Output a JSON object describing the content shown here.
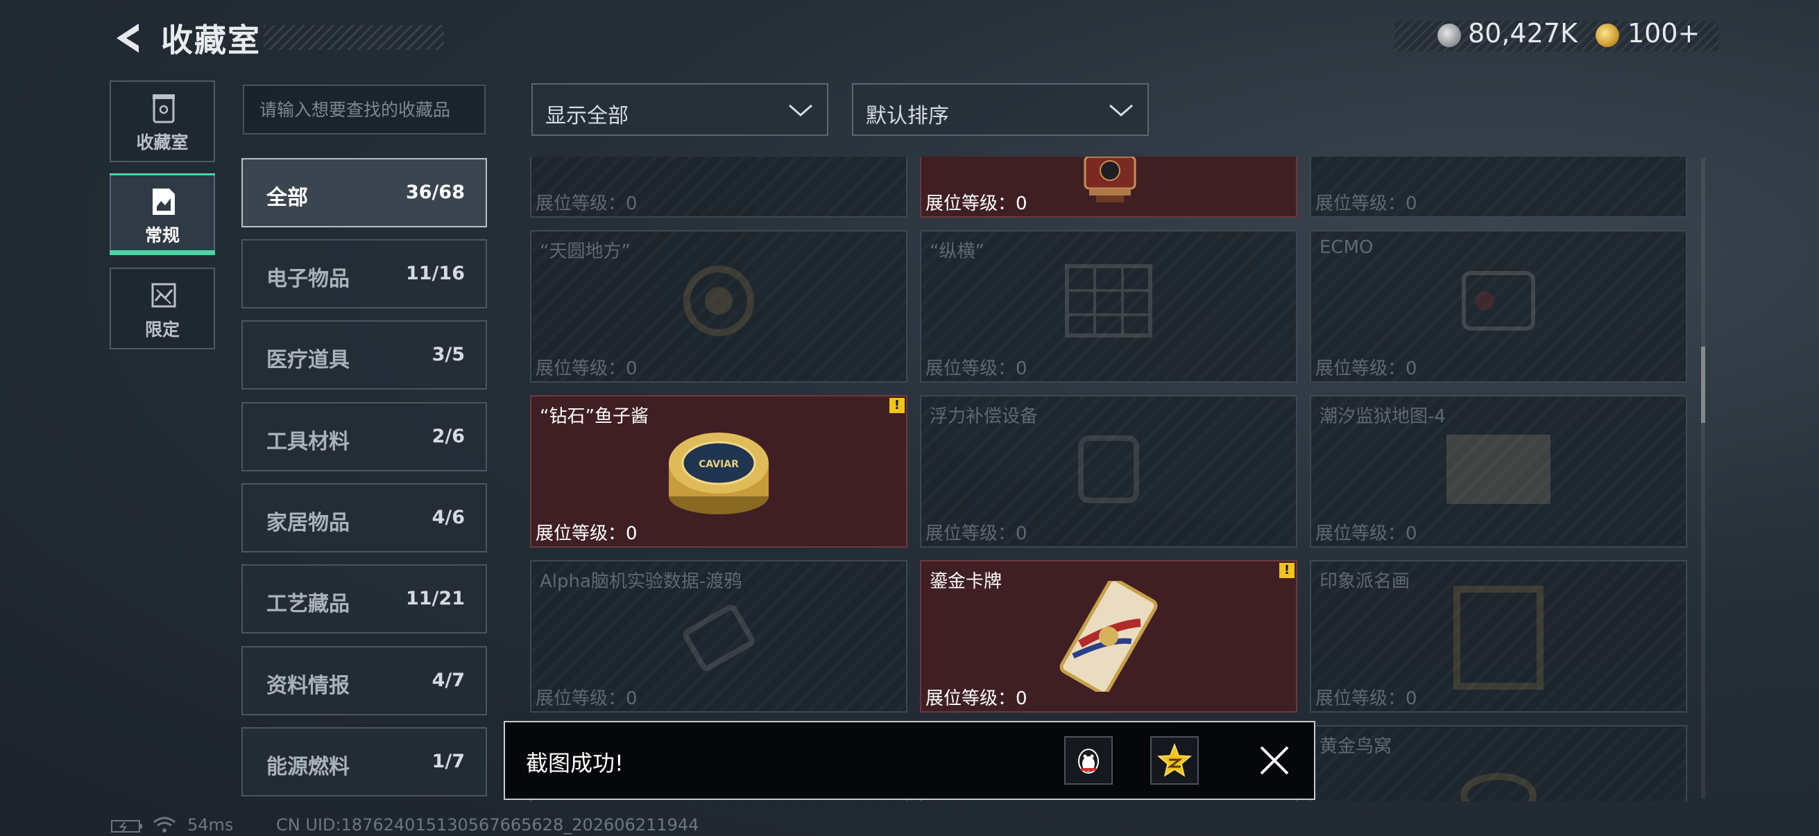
{
  "header": {
    "title": "收藏室",
    "currency": {
      "silver_value": "80,427K",
      "gold_value": "100+"
    }
  },
  "sidebar": {
    "tabs": [
      {
        "label": "收藏室",
        "icon": "collection-icon"
      },
      {
        "label": "常规",
        "icon": "document-icon",
        "active": true
      },
      {
        "label": "限定",
        "icon": "limited-icon"
      }
    ]
  },
  "search": {
    "placeholder": "请输入想要查找的收藏品"
  },
  "categories": [
    {
      "name": "全部",
      "count": "36/68",
      "active": true
    },
    {
      "name": "电子物品",
      "count": "11/16"
    },
    {
      "name": "医疗道具",
      "count": "3/5"
    },
    {
      "name": "工具材料",
      "count": "2/6"
    },
    {
      "name": "家居物品",
      "count": "4/6"
    },
    {
      "name": "工艺藏品",
      "count": "11/21"
    },
    {
      "name": "资料情报",
      "count": "4/7"
    },
    {
      "name": "能源燃料",
      "count": "1/7"
    }
  ],
  "filters": {
    "display": "显示全部",
    "sort": "默认排序"
  },
  "level_label": "展位等级：",
  "grid": {
    "rows": [
      [
        {
          "name": "",
          "level": "0",
          "owned": false
        },
        {
          "name": "",
          "level": "0",
          "owned": true
        },
        {
          "name": "",
          "level": "0",
          "owned": false
        }
      ],
      [
        {
          "name": "“天圆地方”",
          "level": "0",
          "owned": false
        },
        {
          "name": "“纵横”",
          "level": "0",
          "owned": false
        },
        {
          "name": "ECMO",
          "level": "0",
          "owned": false
        }
      ],
      [
        {
          "name": "“钻石”鱼子酱",
          "level": "0",
          "owned": true,
          "alert": "!"
        },
        {
          "name": "浮力补偿设备",
          "level": "0",
          "owned": false
        },
        {
          "name": "潮汐监狱地图-4",
          "level": "0",
          "owned": false
        }
      ],
      [
        {
          "name": "Alpha脑机实验数据-渡鸦",
          "level": "0",
          "owned": false
        },
        {
          "name": "鎏金卡牌",
          "level": "0",
          "owned": true,
          "alert": "!"
        },
        {
          "name": "印象派名画",
          "level": "0",
          "owned": false
        }
      ],
      [
        {
          "name": "",
          "level": "",
          "owned": false
        },
        {
          "name": "",
          "level": "",
          "owned": false
        },
        {
          "name": "黄金鸟窝",
          "level": "",
          "owned": false
        }
      ]
    ],
    "caviar_label": "CAVIAR"
  },
  "toast": {
    "message": "截图成功!"
  },
  "footer": {
    "ping": "54ms",
    "uid": "CN UID:18762401513056766562​8_202606211944"
  },
  "colors": {
    "accent": "#4cd5a3",
    "owned_card": "#3f1f23",
    "alert": "#f0c419"
  }
}
